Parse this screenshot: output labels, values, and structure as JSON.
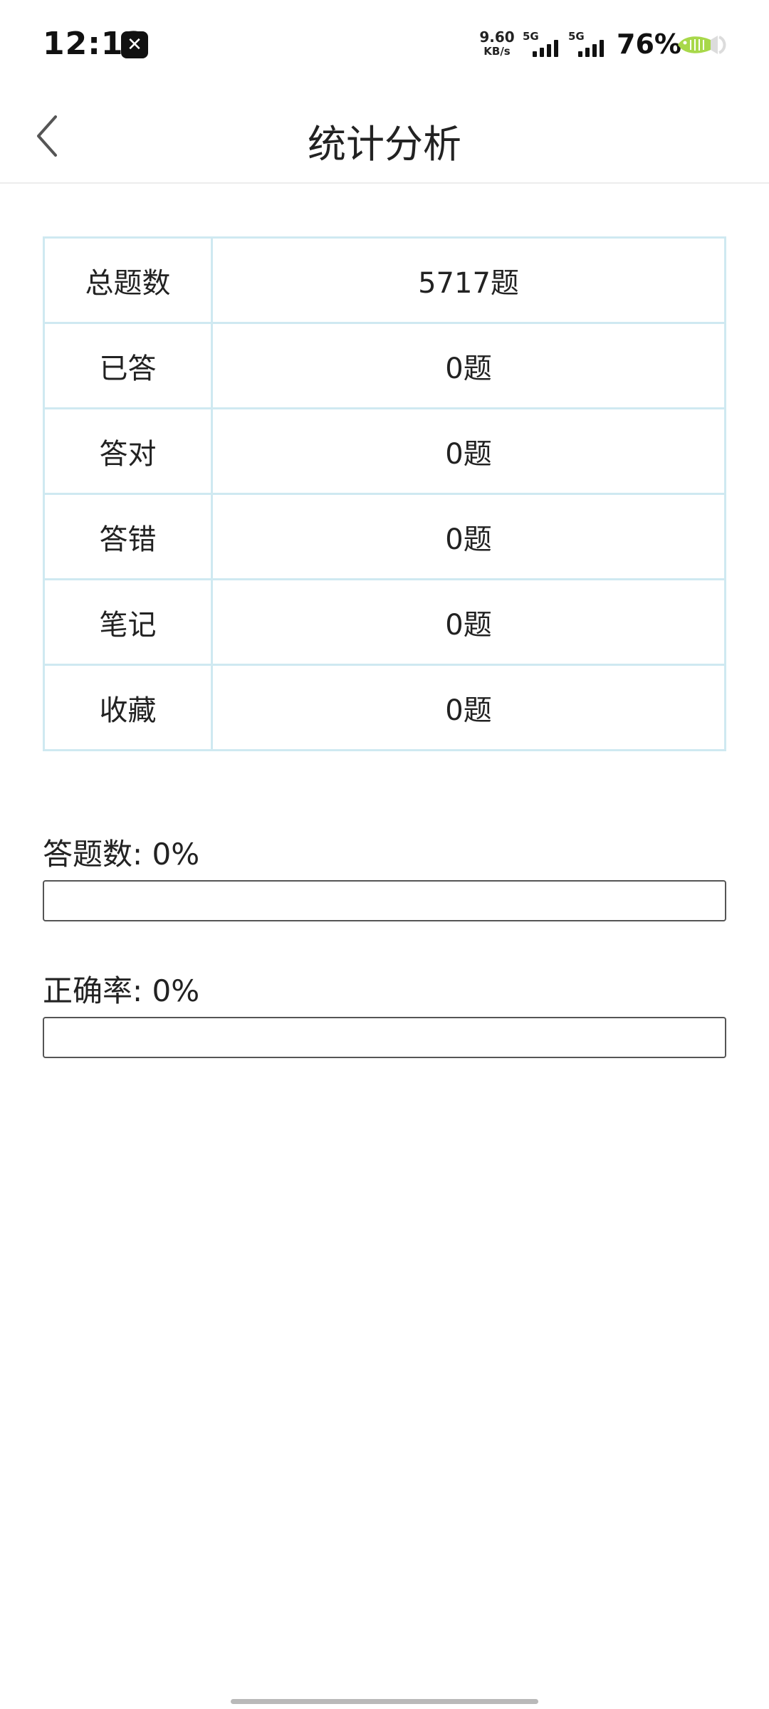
{
  "status_bar": {
    "time": "12:13",
    "app_badge_icon": "capcut-icon",
    "net_speed_value": "9.60",
    "net_speed_unit": "KB/s",
    "signal_1_label": "5G",
    "signal_2_label": "5G",
    "battery_percent": "76%",
    "battery_color": "#a8d84a"
  },
  "header": {
    "title": "统计分析",
    "back_icon": "chevron-left-icon"
  },
  "stats": [
    {
      "label": "总题数",
      "value": "5717题"
    },
    {
      "label": "已答",
      "value": "0题"
    },
    {
      "label": "答对",
      "value": "0题"
    },
    {
      "label": "答错",
      "value": "0题"
    },
    {
      "label": "笔记",
      "value": "0题"
    },
    {
      "label": "收藏",
      "value": "0题"
    }
  ],
  "progress": {
    "answered_label": "答题数: 0%",
    "answered_percent": 0,
    "accuracy_label": "正确率: 0%",
    "accuracy_percent": 0
  },
  "colors": {
    "table_border": "#cfe9f1",
    "progress_border": "#555555"
  }
}
